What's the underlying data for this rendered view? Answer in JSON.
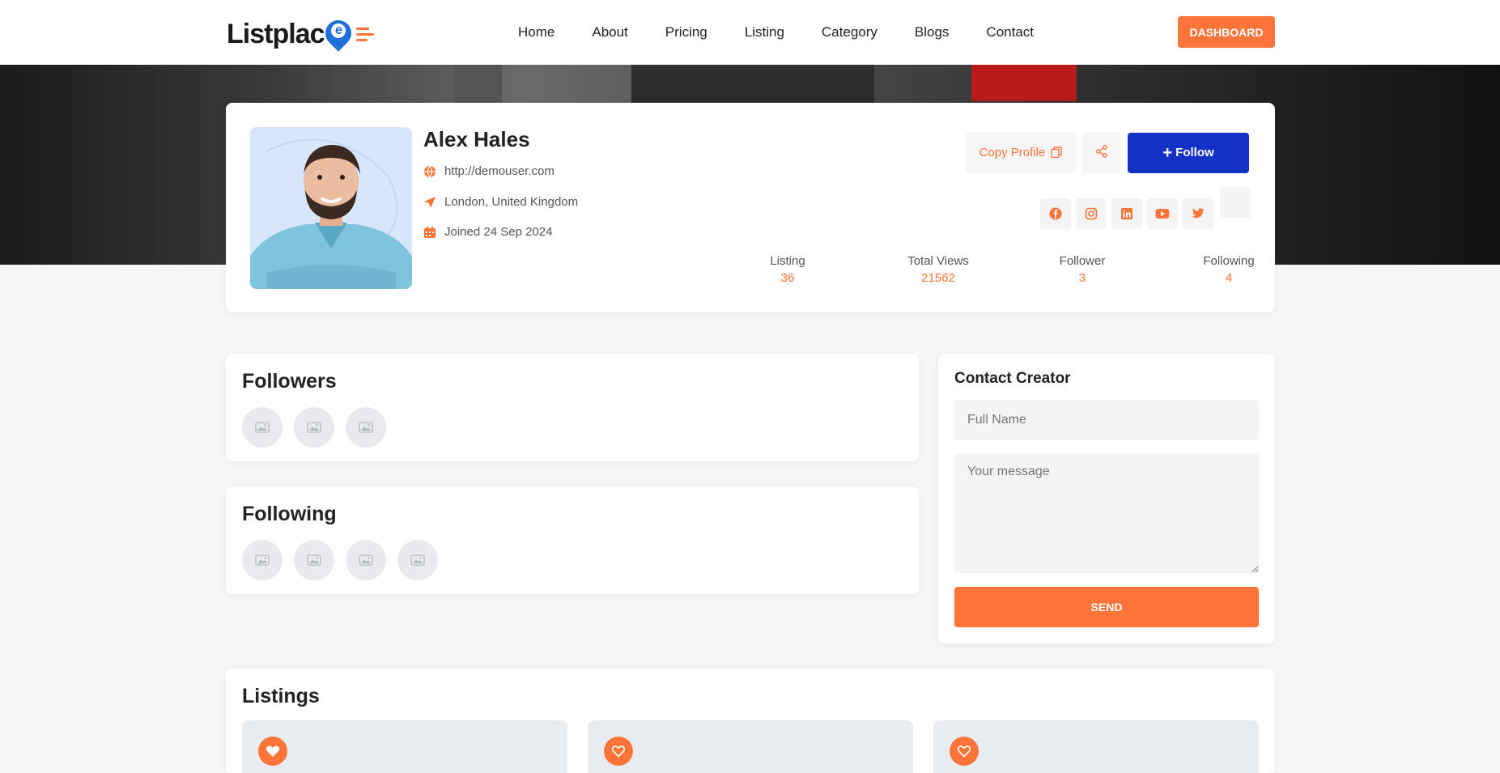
{
  "brand": {
    "logo_text": "Listplac",
    "logo_letter": "e"
  },
  "nav": {
    "items": [
      "Home",
      "About",
      "Pricing",
      "Listing",
      "Category",
      "Blogs",
      "Contact"
    ],
    "dashboard_label": "DASHBOARD"
  },
  "profile": {
    "name": "Alex Hales",
    "website": "http://demouser.com",
    "location": "London, United Kingdom",
    "joined": "Joined 24 Sep 2024",
    "copy_label": "Copy Profile",
    "follow_label": "Follow",
    "socials": [
      "facebook-icon",
      "instagram-icon",
      "linkedin-icon",
      "youtube-icon",
      "twitter-icon"
    ],
    "stats": [
      {
        "label": "Listing",
        "value": "36"
      },
      {
        "label": "Total Views",
        "value": "21562"
      },
      {
        "label": "Follower",
        "value": "3"
      },
      {
        "label": "Following",
        "value": "4"
      }
    ]
  },
  "followers": {
    "title": "Followers",
    "count": 3
  },
  "following": {
    "title": "Following",
    "count": 4
  },
  "contact": {
    "title": "Contact Creator",
    "name_placeholder": "Full Name",
    "message_placeholder": "Your message",
    "send_label": "SEND"
  },
  "listings": {
    "title": "Listings",
    "cards": [
      {
        "favorited": true
      },
      {
        "favorited": false
      },
      {
        "favorited": false
      }
    ]
  },
  "colors": {
    "accent": "#ff7438",
    "primary": "#1432c5"
  }
}
